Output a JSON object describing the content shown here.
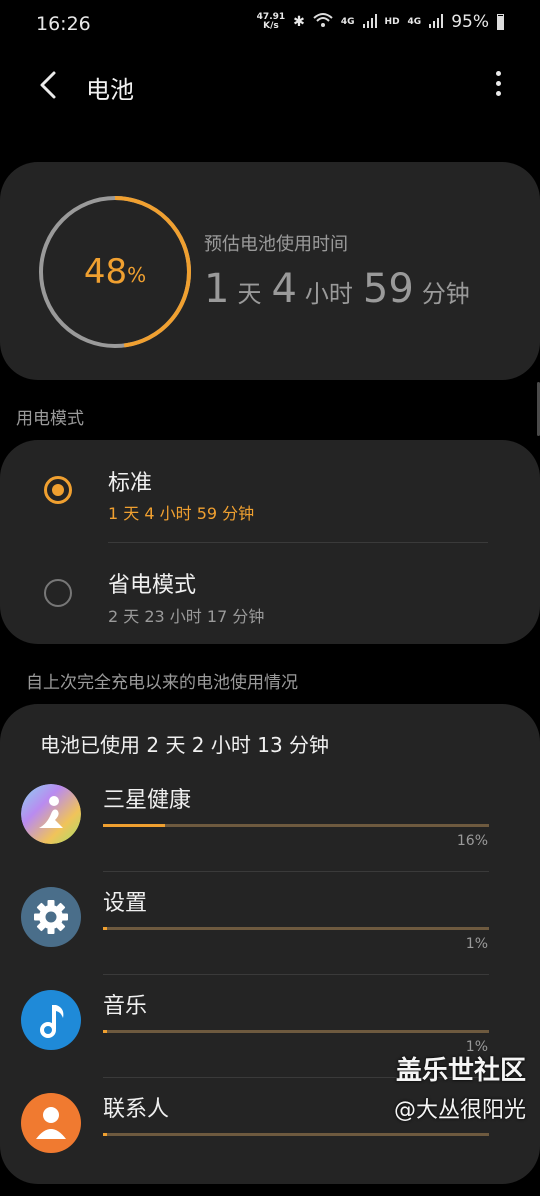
{
  "status_bar": {
    "time": "16:26",
    "net_speed_value": "47.91",
    "net_speed_unit": "K/s",
    "bluetooth_icon": "bluetooth-icon",
    "wifi_icon": "wifi-icon",
    "signal_label_1": "4G",
    "hd_label": "HD",
    "signal_label_2": "4G",
    "battery_percent": "95%"
  },
  "app_bar": {
    "back_icon": "back-arrow-icon",
    "title": "电池",
    "more_icon": "more-vertical-icon"
  },
  "estimate": {
    "percent_value": "48",
    "percent_sign": "%",
    "percent_level": 0.48,
    "label": "预估电池使用时间",
    "days": "1",
    "days_unit": "天",
    "hours": "4",
    "hours_unit": "小时",
    "minutes": "59",
    "minutes_unit": "分钟"
  },
  "power_mode": {
    "section_label": "用电模式",
    "options": [
      {
        "name": "标准",
        "time": "1 天 4 小时 59 分钟",
        "selected": true
      },
      {
        "name": "省电模式",
        "time": "2 天 23 小时 17 分钟",
        "selected": false
      }
    ]
  },
  "usage": {
    "section_label": "自上次完全充电以来的电池使用情况",
    "header": "电池已使用 2 天 2 小时 13 分钟",
    "apps": [
      {
        "name": "三星健康",
        "percent": "16%",
        "level": 0.16,
        "icon": "samsung-health-icon"
      },
      {
        "name": "设置",
        "percent": "1%",
        "level": 0.01,
        "icon": "settings-gear-icon"
      },
      {
        "name": "音乐",
        "percent": "1%",
        "level": 0.01,
        "icon": "music-note-icon"
      },
      {
        "name": "联系人",
        "percent": "",
        "level": 0.01,
        "icon": "contact-person-icon"
      }
    ]
  },
  "watermark": {
    "line1": "盖乐世社区",
    "line2": "@大丛很阳光"
  },
  "colors": {
    "accent": "#f0a030",
    "background": "#000000",
    "card": "#242424",
    "muted_text": "#9a9a9a"
  }
}
